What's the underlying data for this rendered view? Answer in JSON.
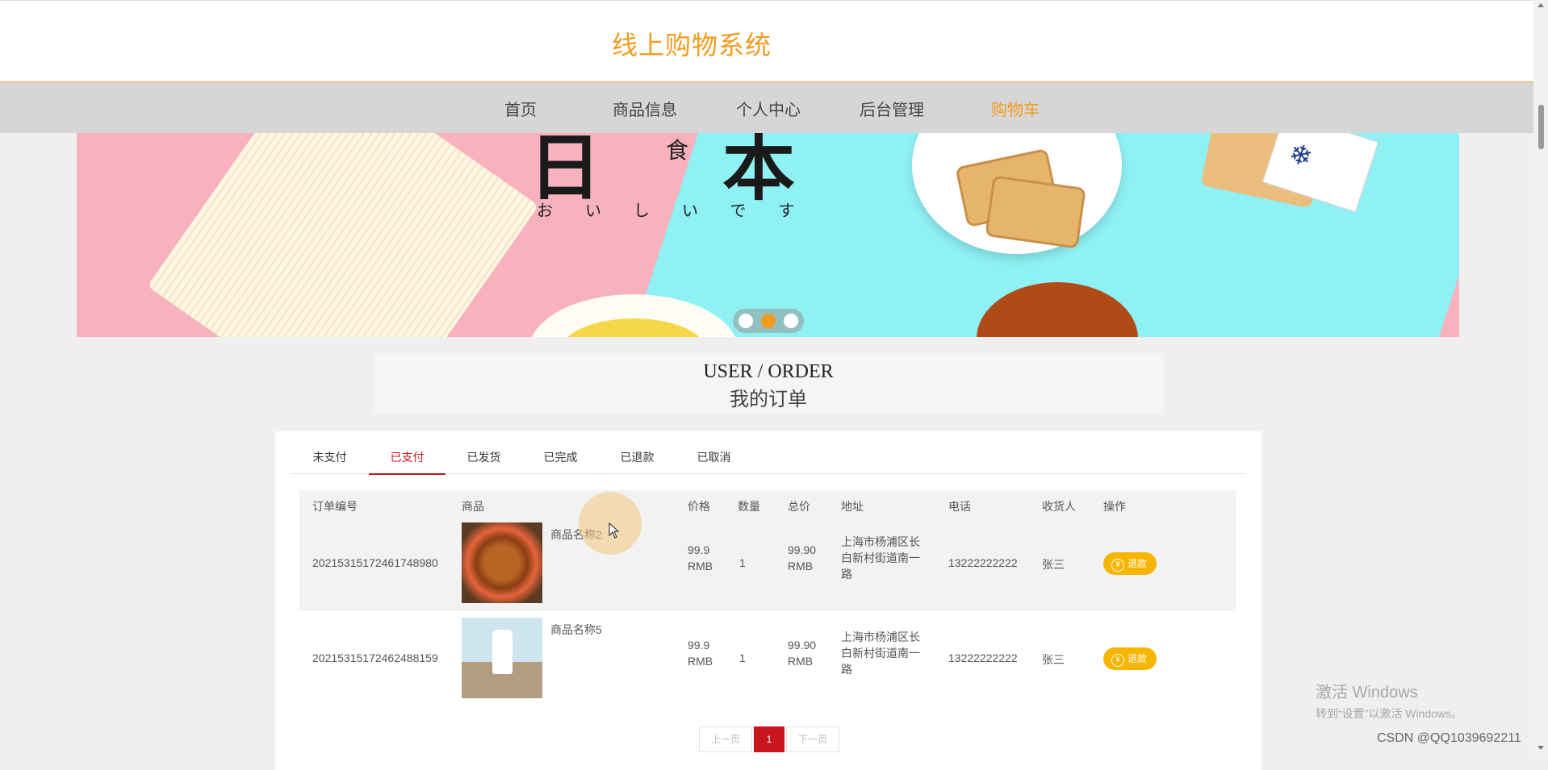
{
  "header": {
    "site_title": "线上购物系统"
  },
  "nav": {
    "items": [
      {
        "label": "首页",
        "active": false
      },
      {
        "label": "商品信息",
        "active": false
      },
      {
        "label": "个人中心",
        "active": false
      },
      {
        "label": "后台管理",
        "active": false
      },
      {
        "label": "购物车",
        "active": true
      }
    ],
    "accent_color": "#f29c1f"
  },
  "banner": {
    "chars": [
      "日",
      "食",
      "本"
    ],
    "kana": "おいしいです",
    "slide_count": 3,
    "active_slide": 2
  },
  "section": {
    "title_en": "USER / ORDER",
    "title_cn": "我的订单"
  },
  "tabs": [
    {
      "label": "未支付",
      "active": false
    },
    {
      "label": "已支付",
      "active": true
    },
    {
      "label": "已发货",
      "active": false
    },
    {
      "label": "已完成",
      "active": false
    },
    {
      "label": "已退款",
      "active": false
    },
    {
      "label": "已取消",
      "active": false
    }
  ],
  "table": {
    "headers": [
      "订单编号",
      "商品",
      "价格",
      "数量",
      "总价",
      "地址",
      "电话",
      "收货人",
      "操作"
    ],
    "rows": [
      {
        "order_no": "20215315172461748980",
        "product_name": "商品名称2",
        "product_image": "fried-chicken-image",
        "price_value": "99.9",
        "price_unit": "RMB",
        "quantity": "1",
        "total_value": "99.90",
        "total_unit": "RMB",
        "address": [
          "上海市杨浦区长",
          "白新村街道南一",
          "路"
        ],
        "phone": "13222222222",
        "receiver": "张三",
        "action_label": "退款",
        "action_icon": "yen-icon"
      },
      {
        "order_no": "20215315172462488159",
        "product_name": "商品名称5",
        "product_image": "milk-image",
        "price_value": "99.9",
        "price_unit": "RMB",
        "quantity": "1",
        "total_value": "99.90",
        "total_unit": "RMB",
        "address": [
          "上海市杨浦区长",
          "白新村街道南一",
          "路"
        ],
        "phone": "13222222222",
        "receiver": "张三",
        "action_label": "退款",
        "action_icon": "yen-icon"
      }
    ]
  },
  "pagination": {
    "prev": "上一页",
    "current": "1",
    "next": "下一页"
  },
  "overlay": {
    "watermark_line1": "激活 Windows",
    "watermark_line2": "转到“设置”以激活 Windows。",
    "credit": "CSDN @QQ1039692211"
  },
  "colors": {
    "tab_active": "#c9151e",
    "refund_button": "#f7b500"
  }
}
